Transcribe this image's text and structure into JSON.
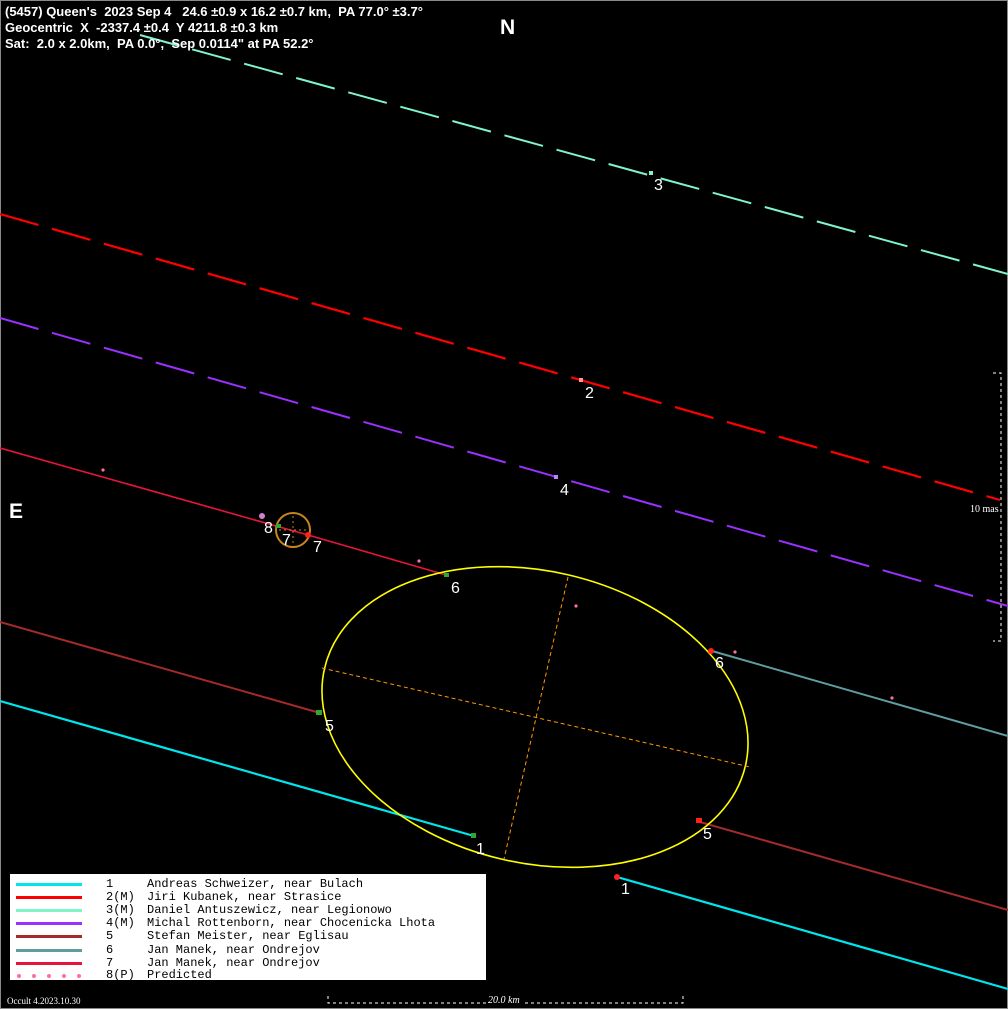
{
  "header": {
    "line1": "(5457) Queen's  2023 Sep 4   24.6 ±0.9 x 16.2 ±0.7 km,  PA 77.0° ±3.7°",
    "line2": "Geocentric  X  -2337.4 ±0.4  Y 4211.8 ±0.3 km",
    "line3": "Sat:  2.0 x 2.0km,  PA 0.0°,  Sep 0.0114\" at PA 52.2°"
  },
  "compass": {
    "north": "N",
    "east": "E"
  },
  "scale": {
    "vertical_label": "10 mas",
    "horizontal_label": "20.0 km"
  },
  "footer": "Occult 4.2023.10.30",
  "colors": {
    "background": "#000000",
    "ellipse": "#ffff00",
    "axes": "#ff9900",
    "satellite": "#c8861e",
    "predicted": "#ff6fa0"
  },
  "chords": [
    {
      "id": "1",
      "color": "#00e6ee",
      "style": "solid"
    },
    {
      "id": "2",
      "color": "#ff0000",
      "style": "dashed"
    },
    {
      "id": "3",
      "color": "#7ff5c8",
      "style": "dashed"
    },
    {
      "id": "4",
      "color": "#9b30ff",
      "style": "dashed"
    },
    {
      "id": "5",
      "color": "#a52a2a",
      "style": "solid"
    },
    {
      "id": "6",
      "color": "#5f9ea0",
      "style": "solid"
    },
    {
      "id": "7",
      "color": "#e8143c",
      "style": "solid"
    }
  ],
  "legend": [
    {
      "num": "1",
      "name": "Andreas Schweizer, near Bulach",
      "color": "#00e6ee",
      "kind": "line"
    },
    {
      "num": "2(M)",
      "name": "Jiri Kubanek, near Strasice",
      "color": "#ff0000",
      "kind": "line"
    },
    {
      "num": "3(M)",
      "name": "Daniel Antuszewicz, near Legionowo",
      "color": "#7ff5c8",
      "kind": "line"
    },
    {
      "num": "4(M)",
      "name": "Michal Rottenborn, near Chocenicka Lhota",
      "color": "#9b30ff",
      "kind": "line"
    },
    {
      "num": "5",
      "name": "Stefan Meister, near Eglisau",
      "color": "#a52a2a",
      "kind": "line"
    },
    {
      "num": "6",
      "name": "Jan Manek, near Ondrejov",
      "color": "#5f9ea0",
      "kind": "line"
    },
    {
      "num": "7",
      "name": "Jan Manek, near Ondrejov",
      "color": "#e8143c",
      "kind": "line"
    },
    {
      "num": "8(P)",
      "name": "Predicted",
      "color": "#ff6fa0",
      "kind": "dots"
    }
  ]
}
